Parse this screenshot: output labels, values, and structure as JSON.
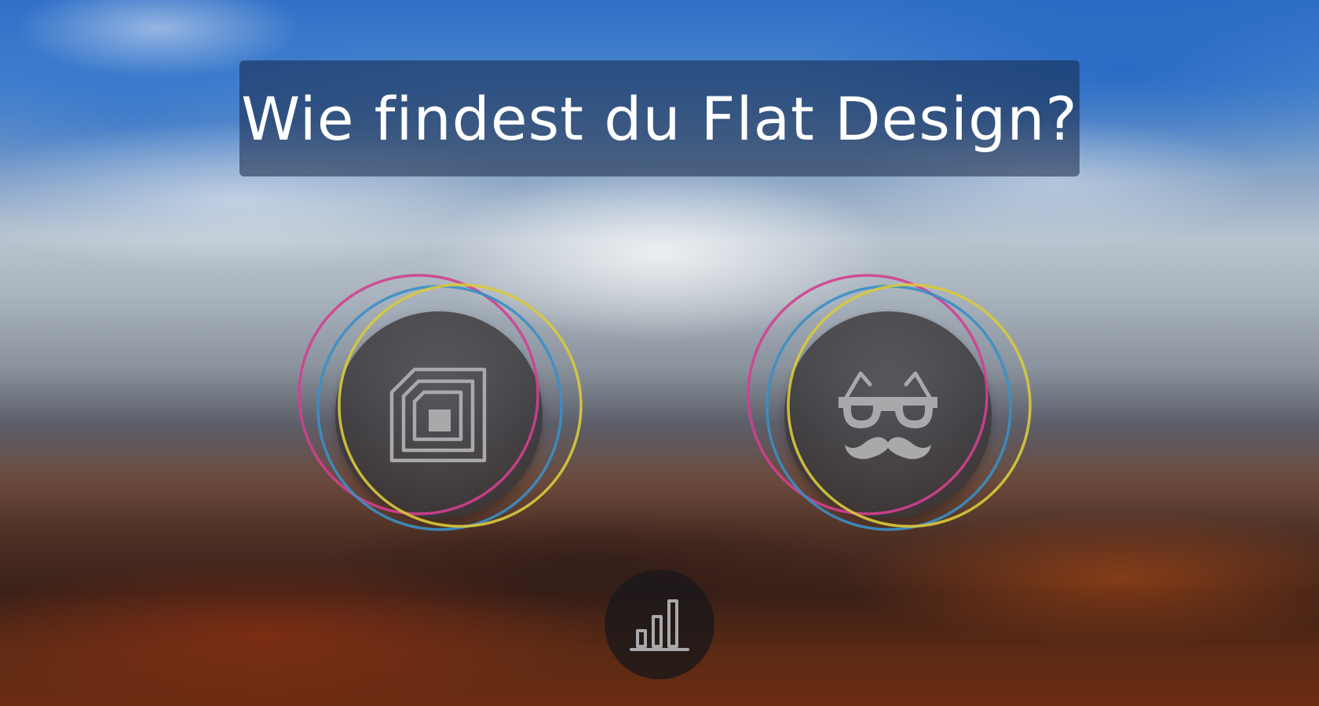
{
  "question": {
    "title": "Wie findest du Flat Design?"
  },
  "options": [
    {
      "icon": "nfc-chip-icon"
    },
    {
      "icon": "hipster-glasses-mustache-icon"
    }
  ],
  "stats_button": {
    "icon": "bar-chart-icon"
  },
  "colors": {
    "ring_magenta": "#d2408f",
    "ring_yellow": "#d9c93c",
    "ring_blue": "#3a8fc6",
    "icon_gray": "#a9a9ab",
    "title_bar": "#16264a"
  }
}
